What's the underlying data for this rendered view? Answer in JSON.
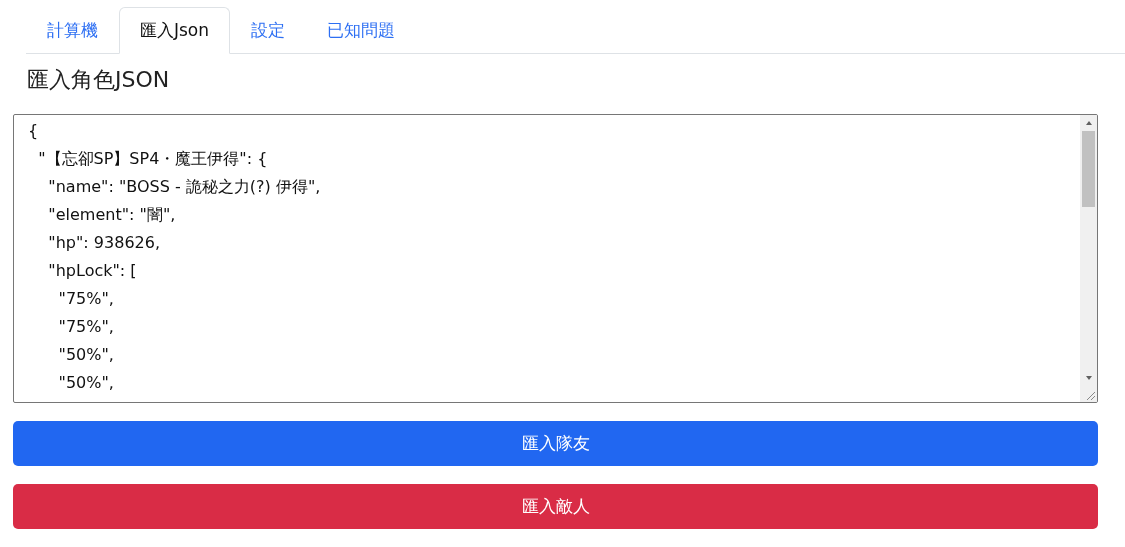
{
  "tabs": [
    {
      "label": "計算機",
      "selected": false
    },
    {
      "label": "匯入Json",
      "selected": true
    },
    {
      "label": "設定",
      "selected": false
    },
    {
      "label": "已知問題",
      "selected": false
    }
  ],
  "heading": "匯入角色JSON",
  "json_field": {
    "value": "{\n  \"【忘卻SP】SP4・魔王伊得\": {\n    \"name\": \"BOSS - 詭秘之力(?) 伊得\",\n    \"element\": \"闇\",\n    \"hp\": 938626,\n    \"hpLock\": [\n      \"75%\",\n      \"75%\",\n      \"50%\",\n      \"50%\","
  },
  "buttons": [
    {
      "label": "匯入隊友",
      "kind": "primary"
    },
    {
      "label": "匯入敵人",
      "kind": "danger"
    }
  ]
}
